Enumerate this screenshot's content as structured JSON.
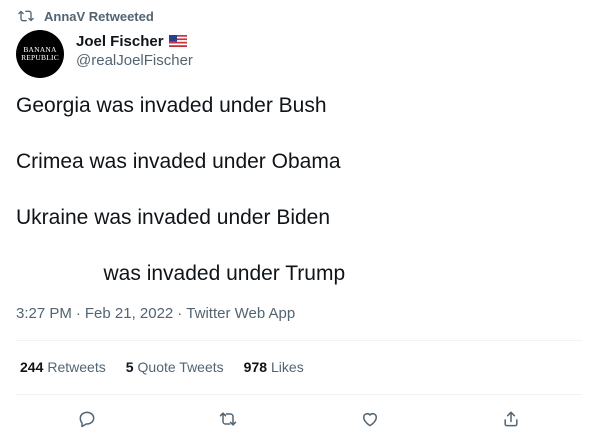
{
  "retweet_context": {
    "text": "AnnaV Retweeted",
    "icon": "retweet-icon"
  },
  "author": {
    "avatar_text_line1": "BANANA",
    "avatar_text_line2": "REPUBLIC",
    "name": "Joel Fischer",
    "flag_icon": "us-flag-icon",
    "handle": "@realJoelFischer"
  },
  "tweet": {
    "lines": [
      "Georgia was invaded under Bush",
      "Crimea was invaded under Obama",
      "Ukraine was invaded under Biden",
      "               was invaded under Trump"
    ],
    "time": "3:27 PM",
    "date": "Feb 21, 2022",
    "source": "Twitter Web App",
    "separator": "·"
  },
  "stats": {
    "retweets_count": "244",
    "retweets_label": "Retweets",
    "quotes_count": "5",
    "quotes_label": "Quote Tweets",
    "likes_count": "978",
    "likes_label": "Likes"
  },
  "colors": {
    "text": "#0f1419",
    "muted": "#536471",
    "divider": "#eff3f4"
  }
}
